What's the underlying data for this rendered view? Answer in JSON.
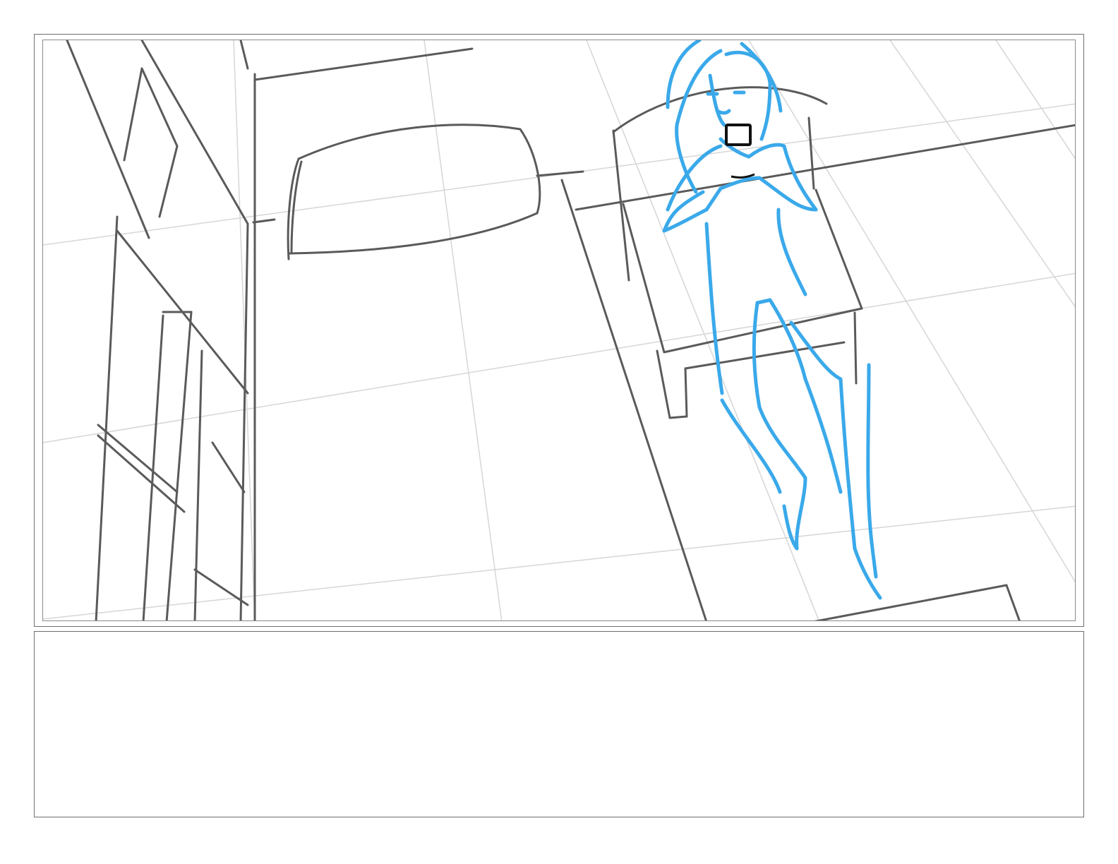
{
  "storyboard": {
    "panel": {
      "scene": "sketch-girl-on-bed-with-phone",
      "colors": {
        "background": "#ffffff",
        "frame": "#6f6f6f",
        "perspective_grid": "#d6d6d6",
        "pencil": "#5a5a5a",
        "character": "#3aa9ea",
        "phone": "#111111"
      }
    },
    "notes": {
      "text": ""
    }
  }
}
